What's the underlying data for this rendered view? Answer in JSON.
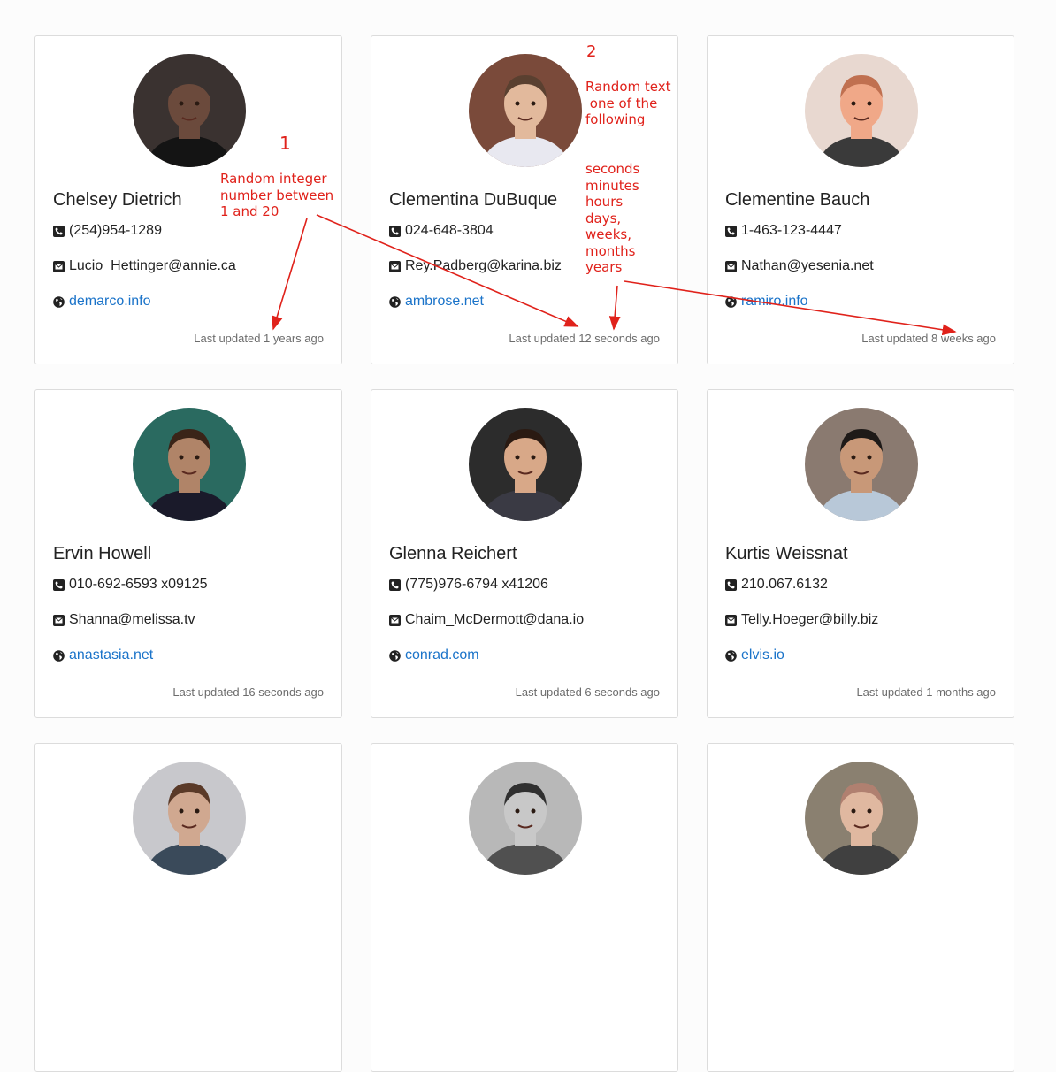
{
  "cards": [
    {
      "name": "Chelsey Dietrich",
      "phone": "(254)954-1289",
      "email": "Lucio_Hettinger@annie.ca",
      "website": "demarco.info",
      "updated": "Last updated 1 years ago",
      "avatar": {
        "bg": "#3a3230",
        "skin": "#6b4a3c",
        "shirt": "#141414",
        "hair": "#3a3230"
      }
    },
    {
      "name": "Clementina DuBuque",
      "phone": "024-648-3804",
      "email": "Rey.Padberg@karina.biz",
      "website": "ambrose.net",
      "updated": "Last updated 12 seconds ago",
      "avatar": {
        "bg": "#7a4a3a",
        "skin": "#e2b99c",
        "shirt": "#e8e8f0",
        "hair": "#5a4030"
      }
    },
    {
      "name": "Clementine Bauch",
      "phone": "1-463-123-4447",
      "email": "Nathan@yesenia.net",
      "website": "ramiro.info",
      "updated": "Last updated 8 weeks ago",
      "avatar": {
        "bg": "#e8d8d0",
        "skin": "#f0a888",
        "shirt": "#3a3a3a",
        "hair": "#c07050"
      }
    },
    {
      "name": "Ervin Howell",
      "phone": "010-692-6593 x09125",
      "email": "Shanna@melissa.tv",
      "website": "anastasia.net",
      "updated": "Last updated 16 seconds ago",
      "avatar": {
        "bg": "#2a6a60",
        "skin": "#b08468",
        "shirt": "#1a1a2a",
        "hair": "#3a2418"
      }
    },
    {
      "name": "Glenna Reichert",
      "phone": "(775)976-6794 x41206",
      "email": "Chaim_McDermott@dana.io",
      "website": "conrad.com",
      "updated": "Last updated 6 seconds ago",
      "avatar": {
        "bg": "#2c2c2c",
        "skin": "#d8a888",
        "shirt": "#3a3a44",
        "hair": "#2a1a12"
      }
    },
    {
      "name": "Kurtis Weissnat",
      "phone": "210.067.6132",
      "email": "Telly.Hoeger@billy.biz",
      "website": "elvis.io",
      "updated": "Last updated 1 months ago",
      "avatar": {
        "bg": "#8a7a70",
        "skin": "#c89878",
        "shirt": "#b8c8d8",
        "hair": "#1e1a18"
      }
    },
    {
      "name": "",
      "phone": "",
      "email": "",
      "website": "",
      "updated": "",
      "avatar": {
        "bg": "#c8c8cc",
        "skin": "#d0a890",
        "shirt": "#3a4a5a",
        "hair": "#5a3a28"
      }
    },
    {
      "name": "",
      "phone": "",
      "email": "",
      "website": "",
      "updated": "",
      "avatar": {
        "bg": "#b8b8b8",
        "skin": "#c8c8c8",
        "shirt": "#505050",
        "hair": "#303030"
      }
    },
    {
      "name": "",
      "phone": "",
      "email": "",
      "website": "",
      "updated": "",
      "avatar": {
        "bg": "#8a8070",
        "skin": "#e0b8a0",
        "shirt": "#404040",
        "hair": "#b08070"
      }
    }
  ],
  "annotations": {
    "one_number": "1",
    "one_text": "Random integer\nnumber between\n1 and 20",
    "two_number": "2",
    "two_text": "Random text\n one of the\nfollowing",
    "two_list": "seconds\nminutes\nhours\ndays,\nweeks,\nmonths\nyears",
    "color": "#e0221b"
  },
  "icons": {
    "phone": "phone-icon",
    "email": "envelope-icon",
    "website": "globe-icon"
  }
}
